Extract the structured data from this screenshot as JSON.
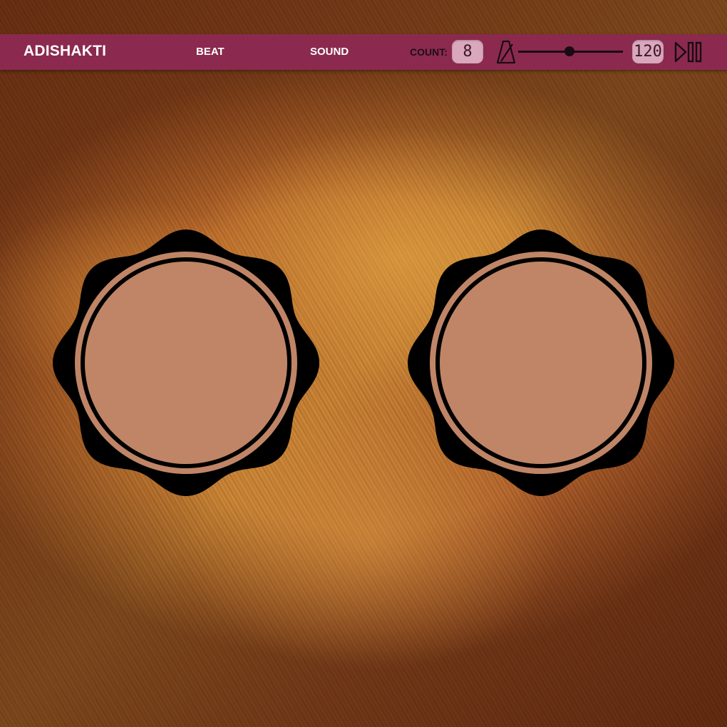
{
  "app": {
    "title": "ADISHAKTI"
  },
  "nav": {
    "beat_label": "BEAT",
    "sound_label": "SOUND"
  },
  "controls": {
    "count_label": "COUNT:",
    "count_value": "8",
    "tempo_value": "120",
    "tempo_slider_fraction": 0.49,
    "metronome_icon": "metronome-icon",
    "play_pause_icon": "play-pause-icon"
  },
  "drums": [
    {
      "name": "drum-pad-left"
    },
    {
      "name": "drum-pad-right"
    }
  ],
  "colors": {
    "topbar": "#8b2a4e",
    "lcd": "#d9a8bc",
    "drum_skin": "#c08566",
    "drum_rim": "#000000"
  }
}
